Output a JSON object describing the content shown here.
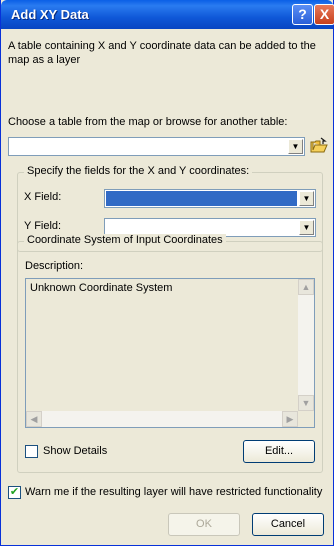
{
  "window": {
    "title": "Add XY Data",
    "help_glyph": "?",
    "close_glyph": "X"
  },
  "intro_text": "A table containing X and Y coordinate data can be added to the map as a layer",
  "table_section": {
    "prompt": "Choose a table from the map or browse for another table:",
    "selected_table": ""
  },
  "fields_group": {
    "title": "Specify the fields for the X and Y coordinates:",
    "x_label": "X Field:",
    "x_value": "",
    "y_label": "Y Field:",
    "y_value": ""
  },
  "coord_group": {
    "title": "Coordinate System of Input Coordinates",
    "description_label": "Description:",
    "description_text": "Unknown Coordinate System",
    "show_details_label": "Show Details",
    "show_details_checked": false,
    "edit_label": "Edit..."
  },
  "warn": {
    "label": "Warn me if the resulting layer will have restricted functionality",
    "checked": true
  },
  "buttons": {
    "ok_label": "OK",
    "cancel_label": "Cancel"
  },
  "icons": {
    "help": "help-icon",
    "close": "close-icon",
    "dropdown": "chevron-down-icon",
    "browse": "open-folder-icon",
    "check": "checkmark-icon"
  },
  "colors": {
    "title_bar": "#0a5fe6",
    "selection": "#316ac5",
    "dialog_bg": "#ece9d8"
  }
}
